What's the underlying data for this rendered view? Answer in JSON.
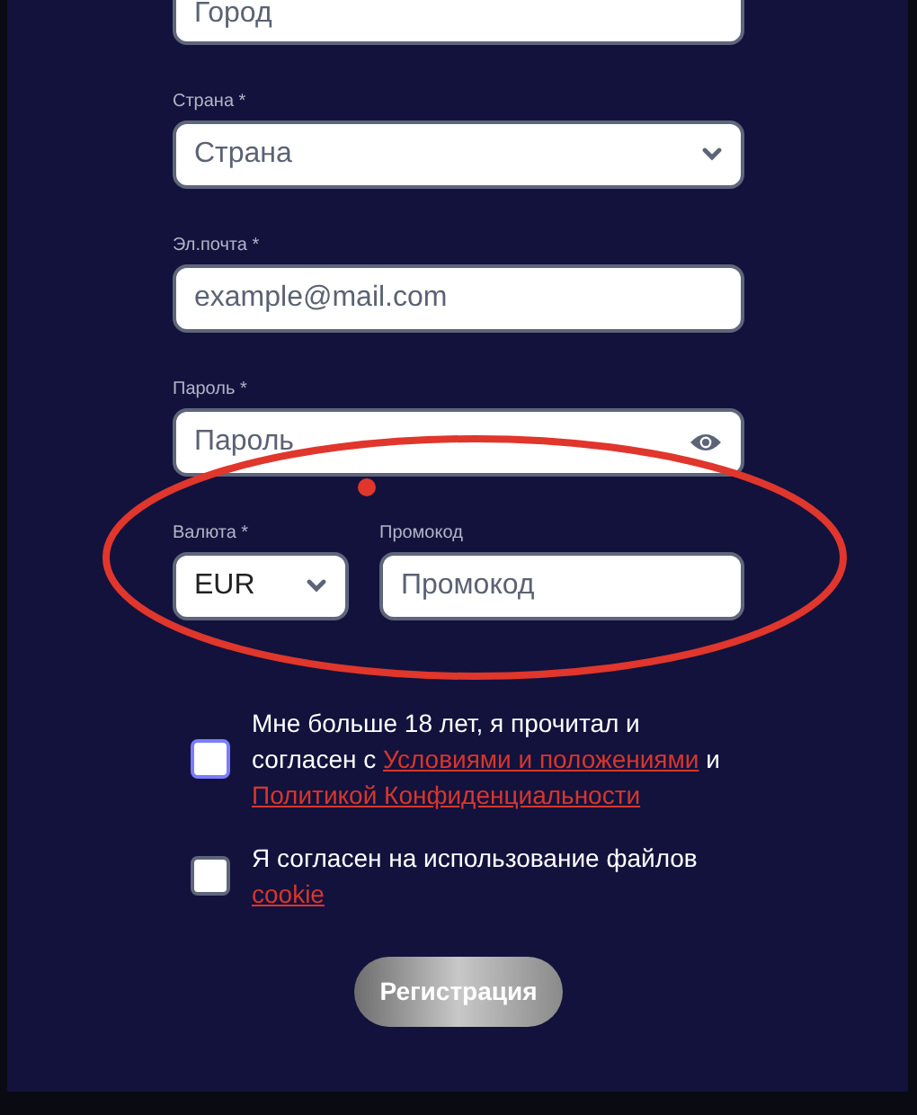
{
  "fields": [
    {
      "kind": "text",
      "placeholder": "Город"
    },
    {
      "kind": "select",
      "label": "Страна *",
      "value": "Страна"
    },
    {
      "kind": "text",
      "label": "Эл.почта *",
      "placeholder": "example@mail.com"
    },
    {
      "kind": "password",
      "label": "Пароль *",
      "placeholder": "Пароль"
    }
  ],
  "currency": {
    "label": "Валюта *",
    "value": "EUR"
  },
  "promo": {
    "label": "Промокод",
    "placeholder": "Промокод"
  },
  "agreements": [
    {
      "checked": false,
      "focused": true,
      "parts": [
        {
          "kind": "text",
          "text": "Мне больше 18 лет, я прочитал и согласен с"
        },
        {
          "kind": "link",
          "text": "Условиями и положениями"
        },
        {
          "kind": "text",
          "text": "и"
        },
        {
          "kind": "link",
          "text": "Политикой Конфиденциальности"
        }
      ]
    },
    {
      "checked": false,
      "focused": false,
      "parts": [
        {
          "kind": "text",
          "text": "Я согласен на использование файлов"
        },
        {
          "kind": "link",
          "text": "cookie"
        }
      ]
    }
  ],
  "submit": {
    "label": "Регистрация"
  },
  "annotation": {
    "kind": "ellipse",
    "color": "#e0362c"
  }
}
